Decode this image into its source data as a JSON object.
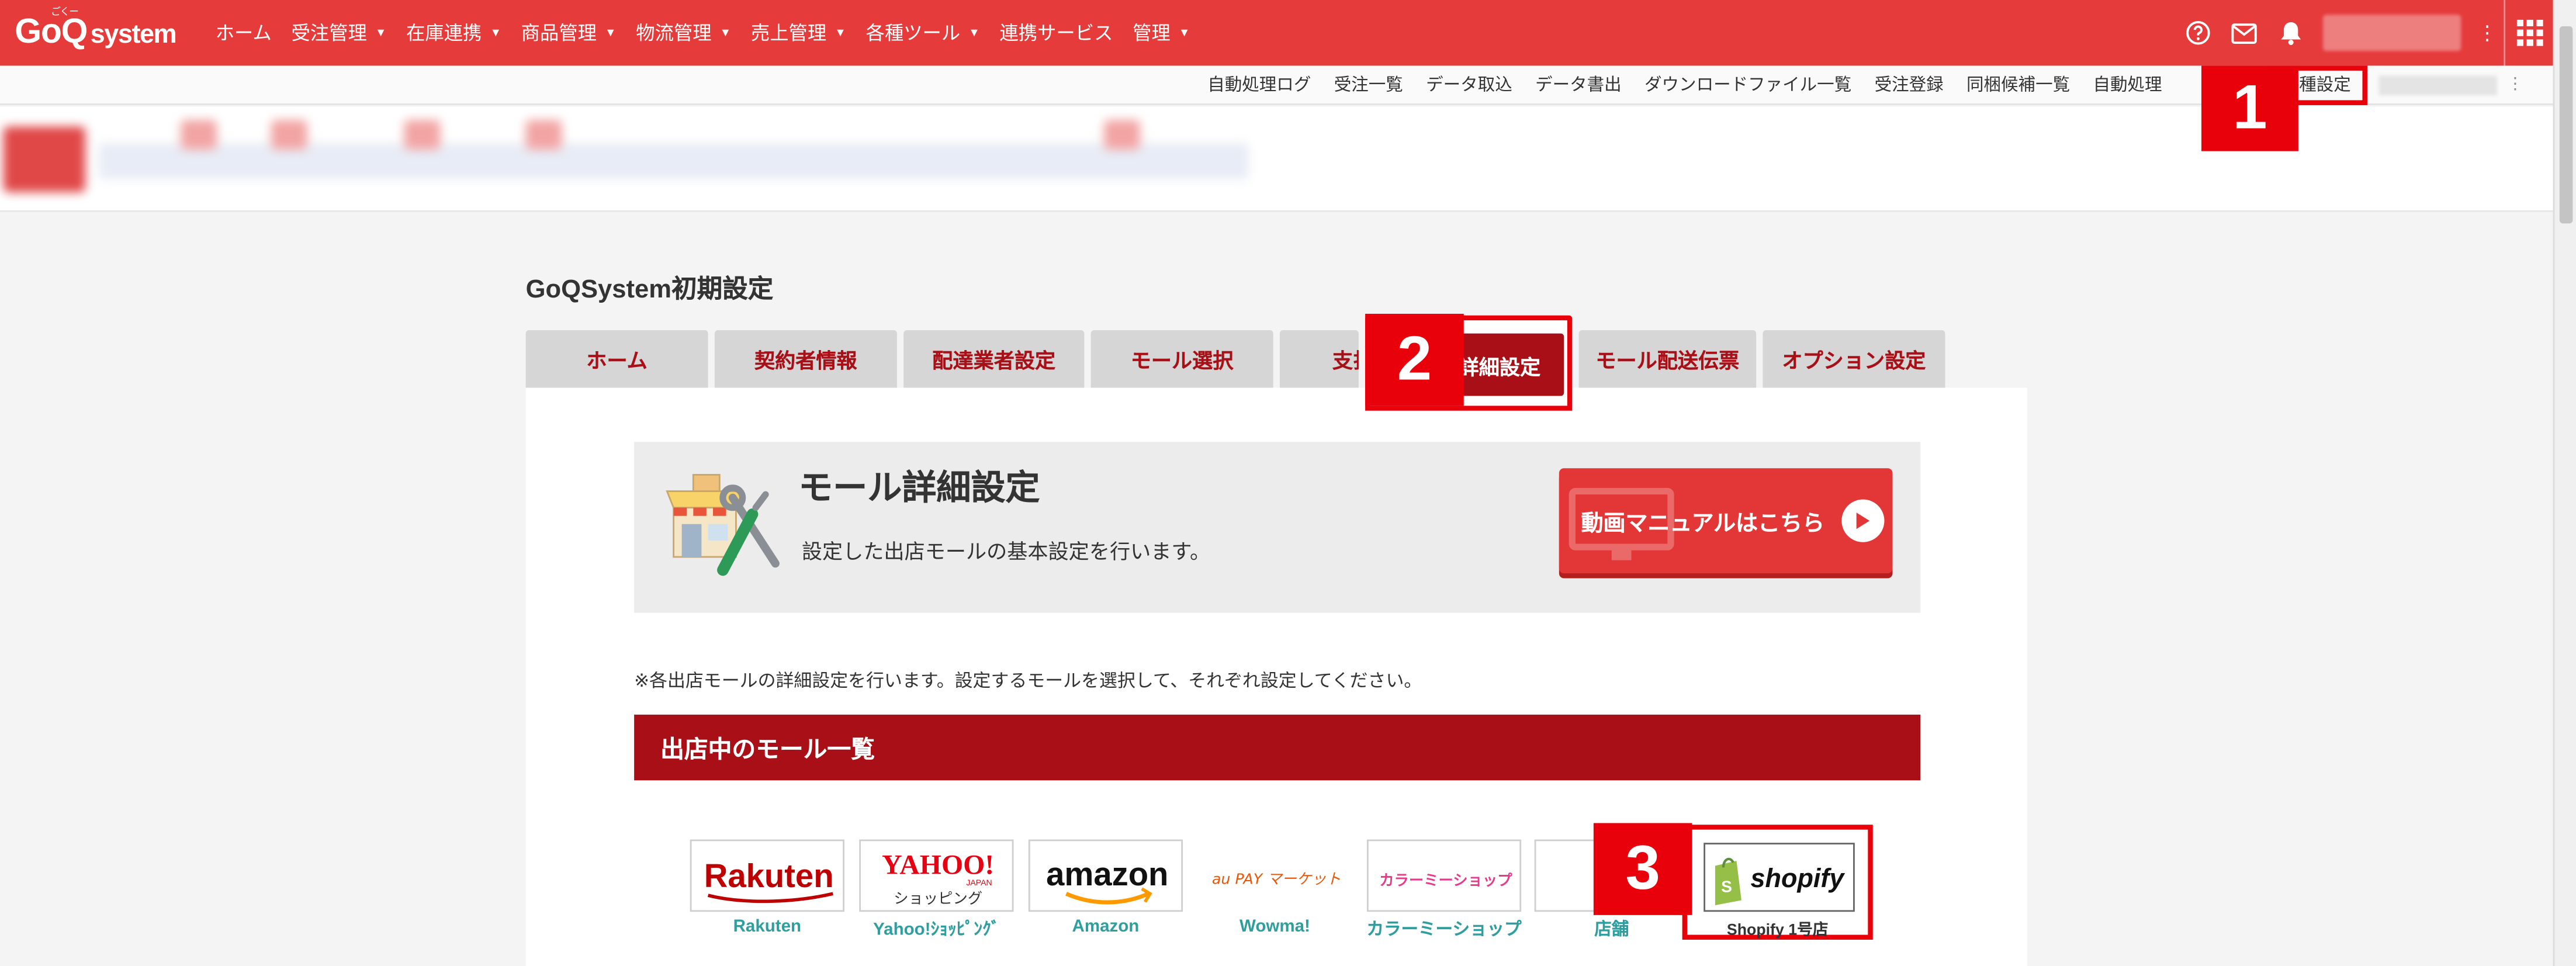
{
  "header": {
    "logo_main": "GoQ",
    "logo_sub": "system",
    "logo_ruby": "ごくー",
    "menu": [
      {
        "label": "ホーム",
        "dropdown": false
      },
      {
        "label": "受注管理",
        "dropdown": true
      },
      {
        "label": "在庫連携",
        "dropdown": true
      },
      {
        "label": "商品管理",
        "dropdown": true
      },
      {
        "label": "物流管理",
        "dropdown": true
      },
      {
        "label": "売上管理",
        "dropdown": true
      },
      {
        "label": "各種ツール",
        "dropdown": true
      },
      {
        "label": "連携サービス",
        "dropdown": false
      },
      {
        "label": "管理",
        "dropdown": true
      }
    ],
    "icons": [
      "help-icon",
      "mail-icon",
      "bell-icon",
      "grid-icon"
    ],
    "color": "#e53b3b"
  },
  "subnav": {
    "items": [
      "自動処理ログ",
      "受注一覧",
      "データ取込",
      "データ書出",
      "ダウンロードファイル一覧",
      "受注登録",
      "同梱候補一覧",
      "自動処理"
    ],
    "active": "各種設定"
  },
  "badges": {
    "one": "1",
    "two": "2",
    "three": "3",
    "color": "#e8000b"
  },
  "page": {
    "title": "GoQSystem初期設定",
    "tabs": [
      "ホーム",
      "契約者情報",
      "配達業者設定",
      "モール選択",
      "支払い",
      "モール詳細設定",
      "モール配送伝票",
      "オプション設定"
    ],
    "active_tab": "モール詳細設定"
  },
  "hero": {
    "title": "モール詳細設定",
    "desc": "設定した出店モールの基本設定を行います。",
    "button": "動画マニュアルはこちら"
  },
  "note": "※各出店モールの詳細設定を行います。設定するモールを選択して、それぞれ設定してください。",
  "mall_section": {
    "header": "出店中のモール一覧",
    "malls": [
      {
        "label": "Rakuten",
        "logo": "Rakuten"
      },
      {
        "label": "Yahoo!ｼｮｯﾋﾟﾝｸﾞ",
        "logo": "YAHOO!",
        "logo_sub": "JAPAN",
        "logo_sub2": "ショッピング"
      },
      {
        "label": "Amazon",
        "logo": "amazon"
      },
      {
        "label": "Wowma!",
        "logo": "au PAY マーケット"
      },
      {
        "label": "カラーミーショップ",
        "logo": "カラーミーショップ"
      },
      {
        "label": "店舗",
        "logo": ""
      }
    ],
    "shopify": {
      "label": "Shopify 1号店",
      "logo": "shopify"
    }
  }
}
